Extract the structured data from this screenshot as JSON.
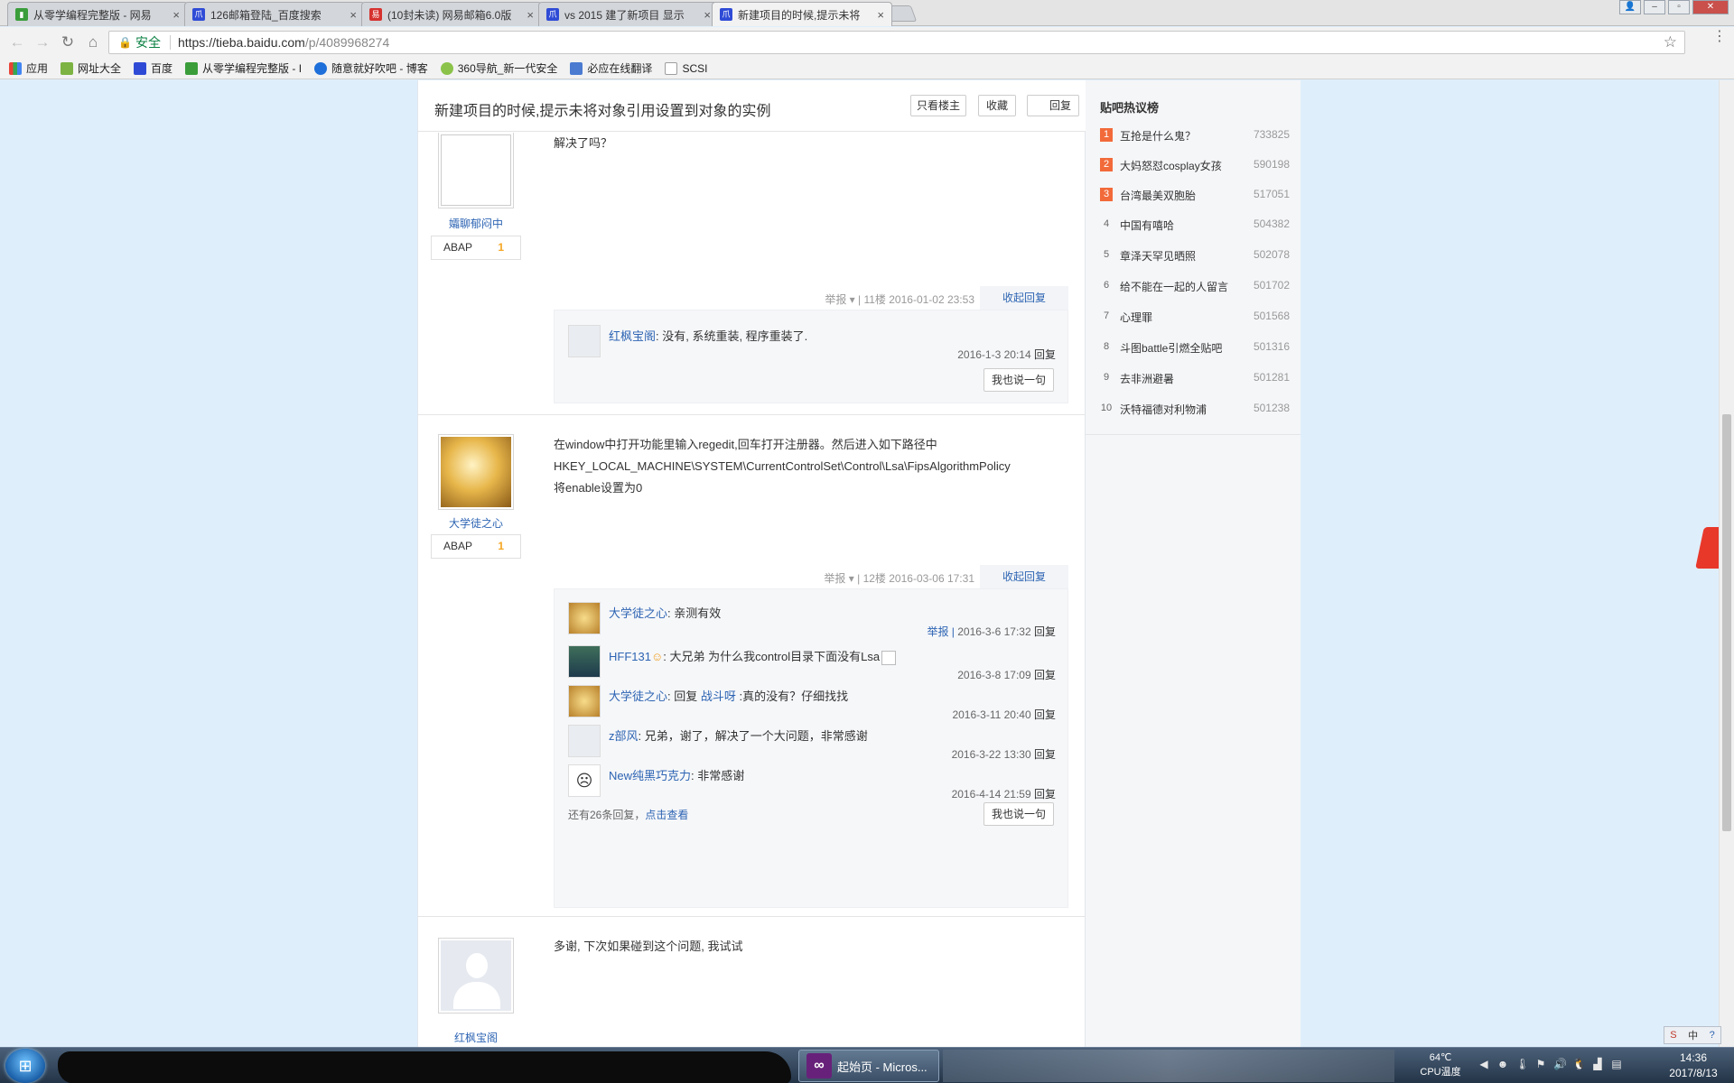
{
  "browser": {
    "tabs": [
      {
        "title": "从零学编程完整版 - 网易",
        "color": "#3a9d3a",
        "glyph": "▮"
      },
      {
        "title": "126邮箱登陆_百度搜索",
        "color": "#2f4bd6",
        "glyph": "爪"
      },
      {
        "title": "(10封未读) 网易邮箱6.0版",
        "color": "#d6322f",
        "glyph": "易"
      },
      {
        "title": "vs 2015 建了新项目 显示",
        "color": "#2f4bd6",
        "glyph": "爪"
      },
      {
        "title": "新建项目的时候,提示未将",
        "color": "#2f4bd6",
        "glyph": "爪"
      }
    ],
    "close_glyph": "×",
    "address": {
      "secure_label": "安全",
      "url_host": "https://tieba.baidu.com",
      "url_path": "/p/4089968274"
    },
    "bookmarks": [
      {
        "label": "应用",
        "color": "#e94235"
      },
      {
        "label": "网址大全",
        "color": "#7cb342"
      },
      {
        "label": "百度",
        "color": "#2f4bd6"
      },
      {
        "label": "从零学编程完整版 - I",
        "color": "#3a9d3a"
      },
      {
        "label": "随意就好吹吧 - 博客",
        "color": "#1e6fd9"
      },
      {
        "label": "360导航_新一代安全",
        "color": "#8bc34a"
      },
      {
        "label": "必应在线翻译",
        "color": "#4a7bd1"
      },
      {
        "label": "SCSI",
        "color": "#9e9e9e"
      }
    ]
  },
  "thread": {
    "title": "新建项目的时候,提示未将对象引用设置到对象的实例",
    "buttons": {
      "only_op": "只看楼主",
      "favorite": "收藏",
      "reply": "回复"
    }
  },
  "posts": [
    {
      "user": "孀聊郁闷中",
      "badge": "ABAP",
      "level": "1",
      "text": [
        "解决了吗？"
      ],
      "meta": "举报 ▾ | 11楼  2016-01-02 23:53",
      "fold": "收起回复",
      "replies": [
        {
          "user": "红枫宝阁",
          "text": ": 没有, 系统重装, 程序重装了.",
          "report": "",
          "time": "2016-1-3 20:14",
          "reply": "回复"
        }
      ],
      "say": "我也说一句"
    },
    {
      "user": "大学徒之心",
      "badge": "ABAP",
      "level": "1",
      "text": [
        "在window中打开功能里输入regedit,回车打开注册器。然后进入如下路径中",
        "HKEY_LOCAL_MACHINE\\SYSTEM\\CurrentControlSet\\Control\\Lsa\\FipsAlgorithmPolicy",
        "将enable设置为0"
      ],
      "meta": "举报 ▾ | 12楼  2016-03-06 17:31",
      "fold": "收起回复",
      "replies": [
        {
          "user": "大学徒之心",
          "text": ": 亲测有效",
          "report": "举报 |",
          "time": "2016-3-6 17:32",
          "reply": "回复"
        },
        {
          "user": "HFF131",
          "text": ": 大兄弟 为什么我control目录下面没有Lsa",
          "report": "",
          "time": "2016-3-8 17:09",
          "reply": "回复"
        },
        {
          "user": "大学徒之心",
          "text": ": 回复 ",
          "mention": "战斗呀",
          "text2": " :真的没有？仔细找找",
          "report": "",
          "time": "2016-3-11 20:40",
          "reply": "回复"
        },
        {
          "user": "z部风",
          "text": ": 兄弟，谢了，解决了一个大问题，非常感谢",
          "report": "",
          "time": "2016-3-22 13:30",
          "reply": "回复"
        },
        {
          "user": "New纯黑巧克力",
          "text": ": 非常感谢",
          "report": "",
          "time": "2016-4-14 21:59",
          "reply": "回复"
        }
      ],
      "more_prefix": "还有26条回复，",
      "more_link": "点击查看",
      "say": "我也说一句"
    },
    {
      "user": "红枫宝阁",
      "text": [
        "多谢, 下次如果碰到这个问题, 我试试"
      ]
    }
  ],
  "sidebar": {
    "title": "贴吧热议榜",
    "items": [
      {
        "no": "1",
        "title": "互抢是什么鬼？",
        "count": "733825"
      },
      {
        "no": "2",
        "title": "大妈怒怼cosplay女孩",
        "count": "590198"
      },
      {
        "no": "3",
        "title": "台湾最美双胞胎",
        "count": "517051"
      },
      {
        "no": "4",
        "title": "中国有嘻哈",
        "count": "504382"
      },
      {
        "no": "5",
        "title": "章泽天罕见晒照",
        "count": "502078"
      },
      {
        "no": "6",
        "title": "给不能在一起的人留言",
        "count": "501702"
      },
      {
        "no": "7",
        "title": "心理罪",
        "count": "501568"
      },
      {
        "no": "8",
        "title": "斗图battle引燃全贴吧",
        "count": "501316"
      },
      {
        "no": "9",
        "title": "去非洲避暑",
        "count": "501281"
      },
      {
        "no": "10",
        "title": "沃特福德对利物浦",
        "count": "501238"
      }
    ]
  },
  "taskbar": {
    "app_label": "起始页 - Micros...",
    "cpu_temp": "64℃",
    "cpu_label": "CPU温度",
    "time": "14:36",
    "date": "2017/8/13"
  }
}
